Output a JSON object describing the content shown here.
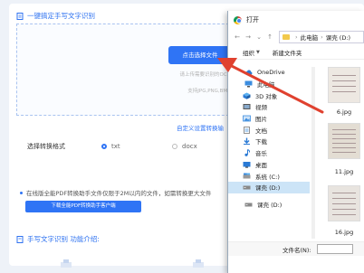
{
  "page": {
    "title": "一键搞定手写文字识别",
    "upload_button": "点击选择文件",
    "upload_hint_line1": "请上传需要识别的OCR文件",
    "upload_hint_line2": "支持JPG,PNG,BMP等",
    "settings_link": "自定义设置转换输",
    "format_label": "选择转换格式",
    "format_options": [
      "txt",
      "docx"
    ],
    "selected_format": "txt",
    "notice": "在线版全能PDF转换助手文件仅限于2M以内的文件，如需转换更大文件",
    "client_button": "下载全能PDF转换助手客户端",
    "section_title": "手写文字识别 功能介绍:",
    "accent_color": "#2f74f5"
  },
  "dialog": {
    "title": "打开",
    "path": [
      "此电脑",
      "课壳 (D:)"
    ],
    "toolbar": {
      "organize": "组织",
      "new_folder": "新建文件夹"
    },
    "nav_items": [
      {
        "label": "OneDrive",
        "icon": "cloud-icon"
      },
      {
        "label": "此电脑",
        "icon": "computer-icon"
      },
      {
        "label": "3D 对象",
        "icon": "cube-icon"
      },
      {
        "label": "视频",
        "icon": "video-icon"
      },
      {
        "label": "图片",
        "icon": "picture-icon"
      },
      {
        "label": "文档",
        "icon": "document-icon"
      },
      {
        "label": "下载",
        "icon": "download-icon"
      },
      {
        "label": "音乐",
        "icon": "music-icon"
      },
      {
        "label": "桌面",
        "icon": "desktop-icon"
      },
      {
        "label": "系统 (C:)",
        "icon": "drive-icon"
      },
      {
        "label": "课壳 (D:)",
        "icon": "drive-icon"
      },
      {
        "label": "课壳 (D:)",
        "icon": "drive-icon"
      }
    ],
    "selected_nav": "课壳 (D:)",
    "files": [
      "6.jpg",
      "11.jpg",
      "16.jpg"
    ],
    "filename_label": "文件名(N):",
    "filename_value": ""
  },
  "annotation": {
    "arrow_color": "#e0412f"
  }
}
